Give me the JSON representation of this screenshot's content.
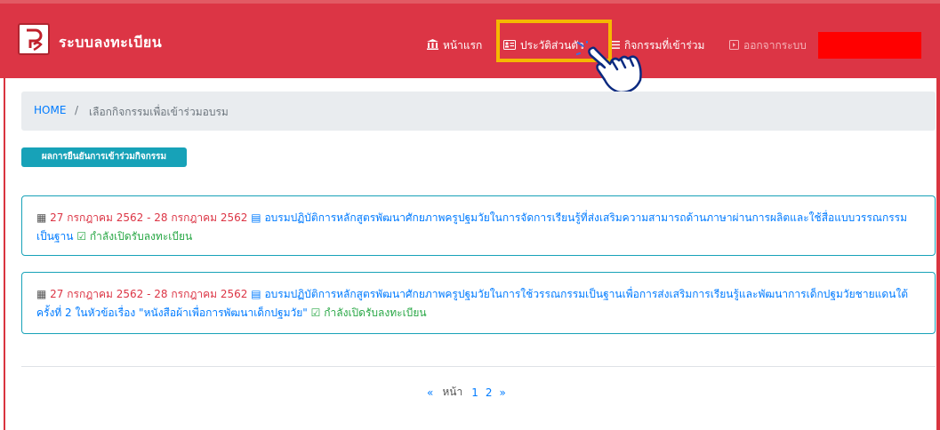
{
  "navbar": {
    "brand": "ระบบลงทะเบียน",
    "items": [
      {
        "label": "หน้าแรก",
        "icon": "bank-icon"
      },
      {
        "label": "ประวัติส่วนตัว",
        "icon": "id-card-icon"
      },
      {
        "label": "กิจกรรมที่เข้าร่วม",
        "icon": "list-icon"
      },
      {
        "label": "ออกจากระบบ",
        "icon": "logout-icon"
      }
    ]
  },
  "breadcrumb": {
    "home": "HOME",
    "separator": "/",
    "current": "เลือกกิจกรรมเพื่อเข้าร่วมอบรม"
  },
  "confirm_button": "ผลการยืนยันการเข้าร่วมกิจกรรม",
  "events": [
    {
      "date": "27 กรกฎาคม 2562 - 28 กรกฎาคม 2562",
      "title": "อบรมปฏิบัติการหลักสูตรพัฒนาศักยภาพครูปฐมวัยในการจัดการเรียนรู้ที่ส่งเสริมความสามารถด้านภาษาผ่านการผลิตและใช้สื่อแบบวรรณกรรมเป็นฐาน",
      "status": "กำลังเปิดรับลงทะเบียน"
    },
    {
      "date": "27 กรกฎาคม 2562 - 28 กรกฎาคม 2562",
      "title": "อบรมปฏิบัติการหลักสูตรพัฒนาศักยภาพครูปฐมวัยในการใช้วรรณกรรมเป็นฐานเพื่อการส่งเสริมการเรียนรู้และพัฒนาการเด็กปฐมวัยชายแดนใต้ ครั้งที่ 2 ในหัวข้อเรื่อง \"หนังสือผ้าเพื่อการพัฒนาเด็กปฐมวัย\"",
      "status": "กำลังเปิดรับลงทะเบียน"
    }
  ],
  "pagination": {
    "prev": "«",
    "label": "หน้า",
    "pages": [
      "1",
      "2"
    ],
    "next": "»"
  },
  "colors": {
    "navbar": "#dc3545",
    "highlight": "#f5b800",
    "link": "#007bff",
    "info": "#17a2b8",
    "success": "#28a745"
  }
}
